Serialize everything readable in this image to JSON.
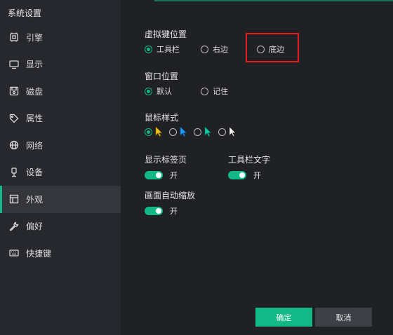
{
  "window": {
    "title": "系统设置"
  },
  "sidebar": {
    "items": [
      {
        "label": "引擎",
        "icon": "engine-icon",
        "active": false
      },
      {
        "label": "显示",
        "icon": "monitor-icon",
        "active": false
      },
      {
        "label": "磁盘",
        "icon": "disk-icon",
        "active": false
      },
      {
        "label": "属性",
        "icon": "tag-icon",
        "active": false
      },
      {
        "label": "网络",
        "icon": "globe-icon",
        "active": false
      },
      {
        "label": "设备",
        "icon": "usb-icon",
        "active": false
      },
      {
        "label": "外观",
        "icon": "appearance-icon",
        "active": true
      },
      {
        "label": "偏好",
        "icon": "wrench-icon",
        "active": false
      },
      {
        "label": "快捷键",
        "icon": "keyboard-icon",
        "active": false
      }
    ]
  },
  "settings": {
    "virtual_key": {
      "label": "虚拟键位置",
      "options": [
        "工具栏",
        "右边",
        "底边"
      ],
      "selected": "工具栏"
    },
    "window_position": {
      "label": "窗口位置",
      "options": [
        "默认",
        "记住"
      ],
      "selected": "默认"
    },
    "mouse_style": {
      "label": "鼠标样式",
      "options": [
        "yellow-cursor",
        "blue-cursor",
        "teal-cursor",
        "white-cursor"
      ],
      "selected": "yellow-cursor"
    },
    "show_tabs": {
      "label": "显示标签页",
      "state": "开",
      "on": true
    },
    "toolbar_text": {
      "label": "工具栏文字",
      "state": "开",
      "on": true
    },
    "auto_scale": {
      "label": "画面自动缩放",
      "state": "开",
      "on": true
    }
  },
  "buttons": {
    "ok": "确定",
    "cancel": "取消"
  },
  "colors": {
    "accent": "#12b886",
    "highlight": "#e0201e",
    "background": "#1f2125",
    "sidebar": "#26282d"
  }
}
